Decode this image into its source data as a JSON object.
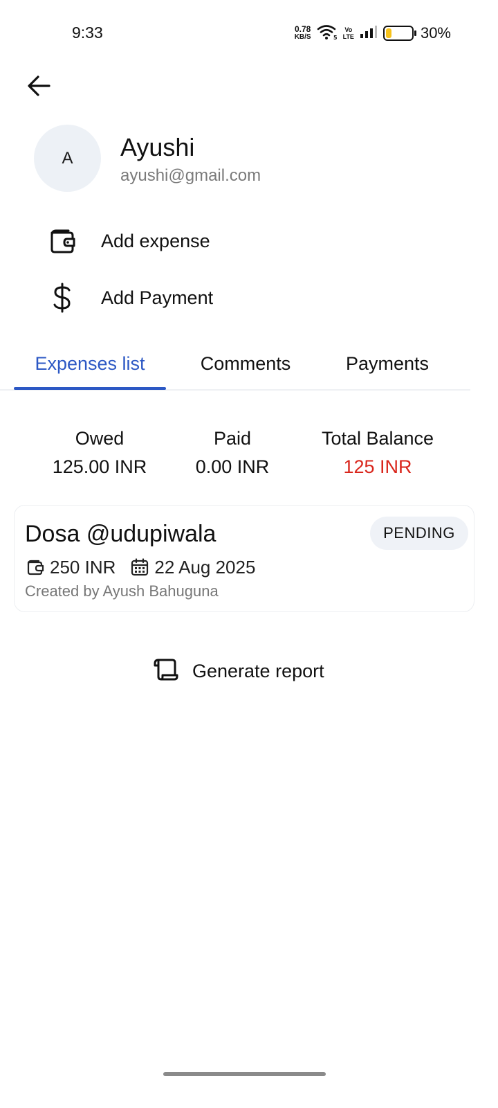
{
  "status_bar": {
    "time": "9:33",
    "net_speed_value": "0.78",
    "net_speed_unit": "KB/S",
    "volte_top": "Vo",
    "volte_bottom": "LTE",
    "battery_percent": "30%",
    "battery_level": 0.3,
    "battery_color": "#f6c21c"
  },
  "header": {
    "back_icon": "arrow-left-icon"
  },
  "profile": {
    "avatar_initial": "A",
    "name": "Ayushi",
    "email": "ayushi@gmail.com"
  },
  "actions": {
    "add_expense": {
      "label": "Add expense",
      "icon": "wallet-icon"
    },
    "add_payment": {
      "label": "Add Payment",
      "icon": "dollar-icon"
    }
  },
  "tabs": [
    {
      "label": "Expenses list",
      "active": true
    },
    {
      "label": "Comments",
      "active": false
    },
    {
      "label": "Payments",
      "active": false
    }
  ],
  "summary": {
    "owed": {
      "title": "Owed",
      "value": "125.00 INR"
    },
    "paid": {
      "title": "Paid",
      "value": "0.00 INR"
    },
    "total": {
      "title": "Total Balance",
      "value": "125 INR"
    }
  },
  "expenses": [
    {
      "title": "Dosa @udupiwala",
      "status": "PENDING",
      "amount": "250 INR",
      "date": "22 Aug 2025",
      "created_by": "Created by Ayush Bahuguna"
    }
  ],
  "report": {
    "label": "Generate report",
    "icon": "scroll-icon"
  },
  "colors": {
    "accent": "#2c58c4",
    "negative": "#d9261c",
    "avatar_bg": "#edf1f6",
    "pill_bg": "#eff2f7"
  }
}
